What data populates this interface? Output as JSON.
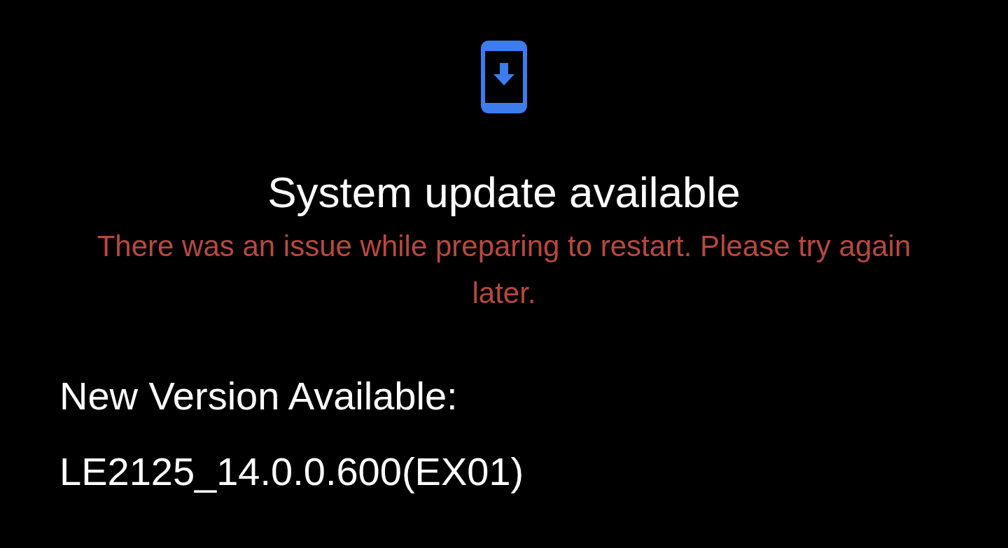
{
  "title": "System update available",
  "error_message": "There was an issue while preparing to restart. Please try again later.",
  "version_label": "New Version Available:",
  "version": "LE2125_14.0.0.600(EX01)"
}
